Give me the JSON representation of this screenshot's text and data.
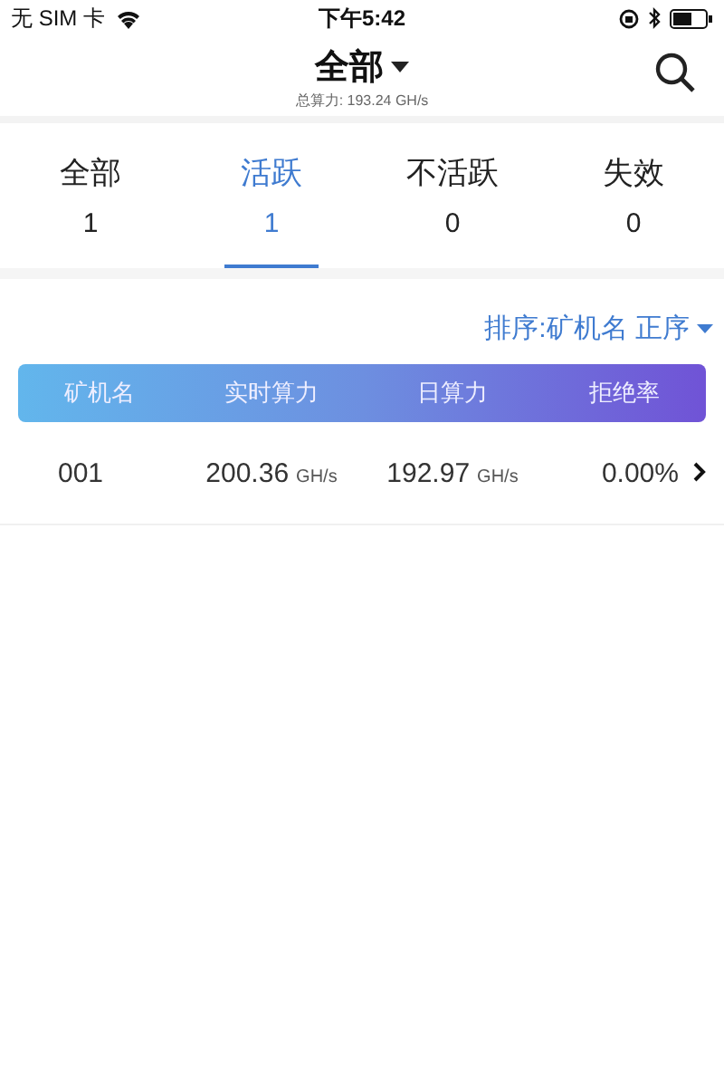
{
  "status_bar": {
    "carrier": "无 SIM 卡",
    "time": "下午5:42"
  },
  "nav": {
    "title": "全部",
    "subtitle": "总算力: 193.24 GH/s"
  },
  "tabs": [
    {
      "label": "全部",
      "count": "1",
      "selected": false
    },
    {
      "label": "活跃",
      "count": "1",
      "selected": true
    },
    {
      "label": "不活跃",
      "count": "0",
      "selected": false
    },
    {
      "label": "失效",
      "count": "0",
      "selected": false
    }
  ],
  "sort": {
    "label": "排序:矿机名 正序"
  },
  "table": {
    "columns": [
      "矿机名",
      "实时算力",
      "日算力",
      "拒绝率"
    ],
    "rows": [
      {
        "name": "001",
        "realtime": "200.36",
        "realtime_unit": "GH/s",
        "daily": "192.97",
        "daily_unit": "GH/s",
        "reject": "0.00%"
      }
    ]
  }
}
